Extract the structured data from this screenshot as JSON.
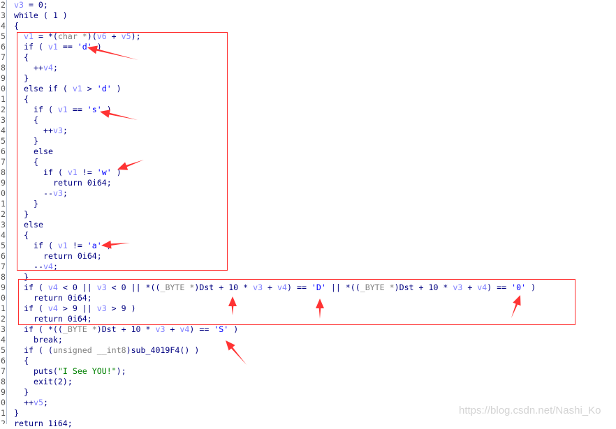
{
  "annotation_color": "#ff3333",
  "watermark": "https://blog.csdn.net/Nashi_Ko",
  "lines": [
    {
      "ln": "2",
      "indent": 0,
      "t": [
        [
          "v3",
          "v"
        ],
        [
          " = 0;",
          "k"
        ]
      ]
    },
    {
      "ln": "3",
      "indent": 0,
      "t": [
        [
          "while ( 1 )",
          "k"
        ]
      ]
    },
    {
      "ln": "4",
      "indent": 0,
      "t": [
        [
          "{",
          "k"
        ]
      ]
    },
    {
      "ln": "5",
      "indent": 1,
      "t": [
        [
          "v1",
          "v"
        ],
        [
          " = *(",
          "k"
        ],
        [
          "char *",
          "g"
        ],
        [
          ")(",
          "k"
        ],
        [
          "v6",
          "v"
        ],
        [
          " + ",
          "k"
        ],
        [
          "v5",
          "v"
        ],
        [
          ");",
          "k"
        ]
      ]
    },
    {
      "ln": "6",
      "indent": 1,
      "t": [
        [
          "if ( ",
          "k"
        ],
        [
          "v1",
          "v"
        ],
        [
          " == ",
          "k"
        ],
        [
          "'d'",
          "c"
        ],
        [
          " )",
          "k"
        ]
      ]
    },
    {
      "ln": "7",
      "indent": 1,
      "t": [
        [
          "{",
          "k"
        ]
      ]
    },
    {
      "ln": "8",
      "indent": 2,
      "t": [
        [
          "++",
          "k"
        ],
        [
          "v4",
          "v"
        ],
        [
          ";",
          "k"
        ]
      ]
    },
    {
      "ln": "9",
      "indent": 1,
      "t": [
        [
          "}",
          "k"
        ]
      ]
    },
    {
      "ln": "0",
      "indent": 1,
      "t": [
        [
          "else if ( ",
          "k"
        ],
        [
          "v1",
          "v"
        ],
        [
          " > ",
          "k"
        ],
        [
          "'d'",
          "c"
        ],
        [
          " )",
          "k"
        ]
      ]
    },
    {
      "ln": "1",
      "indent": 1,
      "t": [
        [
          "{",
          "k"
        ]
      ]
    },
    {
      "ln": "2",
      "indent": 2,
      "t": [
        [
          "if ( ",
          "k"
        ],
        [
          "v1",
          "v"
        ],
        [
          " == ",
          "k"
        ],
        [
          "'s'",
          "c"
        ],
        [
          " )",
          "k"
        ]
      ]
    },
    {
      "ln": "3",
      "indent": 2,
      "t": [
        [
          "{",
          "k"
        ]
      ]
    },
    {
      "ln": "4",
      "indent": 3,
      "t": [
        [
          "++",
          "k"
        ],
        [
          "v3",
          "v"
        ],
        [
          ";",
          "k"
        ]
      ]
    },
    {
      "ln": "5",
      "indent": 2,
      "t": [
        [
          "}",
          "k"
        ]
      ]
    },
    {
      "ln": "6",
      "indent": 2,
      "t": [
        [
          "else",
          "k"
        ]
      ]
    },
    {
      "ln": "7",
      "indent": 2,
      "t": [
        [
          "{",
          "k"
        ]
      ]
    },
    {
      "ln": "8",
      "indent": 3,
      "t": [
        [
          "if ( ",
          "k"
        ],
        [
          "v1",
          "v"
        ],
        [
          " != ",
          "k"
        ],
        [
          "'w'",
          "c"
        ],
        [
          " )",
          "k"
        ]
      ]
    },
    {
      "ln": "9",
      "indent": 4,
      "t": [
        [
          "return 0i64;",
          "k"
        ]
      ]
    },
    {
      "ln": "0",
      "indent": 3,
      "t": [
        [
          "--",
          "k"
        ],
        [
          "v3",
          "v"
        ],
        [
          ";",
          "k"
        ]
      ]
    },
    {
      "ln": "1",
      "indent": 2,
      "t": [
        [
          "}",
          "k"
        ]
      ]
    },
    {
      "ln": "2",
      "indent": 1,
      "t": [
        [
          "}",
          "k"
        ]
      ]
    },
    {
      "ln": "3",
      "indent": 1,
      "t": [
        [
          "else",
          "k"
        ]
      ]
    },
    {
      "ln": "4",
      "indent": 1,
      "t": [
        [
          "{",
          "k"
        ]
      ]
    },
    {
      "ln": "5",
      "indent": 2,
      "t": [
        [
          "if ( ",
          "k"
        ],
        [
          "v1",
          "v"
        ],
        [
          " != ",
          "k"
        ],
        [
          "'a'",
          "c"
        ],
        [
          " )",
          "k"
        ]
      ]
    },
    {
      "ln": "6",
      "indent": 3,
      "t": [
        [
          "return 0i64;",
          "k"
        ]
      ]
    },
    {
      "ln": "7",
      "indent": 2,
      "t": [
        [
          "--",
          "k"
        ],
        [
          "v4",
          "v"
        ],
        [
          ";",
          "k"
        ]
      ]
    },
    {
      "ln": "8",
      "indent": 1,
      "t": [
        [
          "}",
          "k"
        ]
      ]
    },
    {
      "ln": "9",
      "indent": 1,
      "t": [
        [
          "if ( ",
          "k"
        ],
        [
          "v4",
          "v"
        ],
        [
          " < 0 || ",
          "k"
        ],
        [
          "v3",
          "v"
        ],
        [
          " < 0 || *((",
          "k"
        ],
        [
          "_BYTE *",
          "g"
        ],
        [
          ")Dst + 10 * ",
          "k"
        ],
        [
          "v3",
          "v"
        ],
        [
          " + ",
          "k"
        ],
        [
          "v4",
          "v"
        ],
        [
          ") == ",
          "k"
        ],
        [
          "'D'",
          "c"
        ],
        [
          " || *((",
          "k"
        ],
        [
          "_BYTE *",
          "g"
        ],
        [
          ")Dst + 10 * ",
          "k"
        ],
        [
          "v3",
          "v"
        ],
        [
          " + ",
          "k"
        ],
        [
          "v4",
          "v"
        ],
        [
          ") == ",
          "k"
        ],
        [
          "'0'",
          "c"
        ],
        [
          " )",
          "k"
        ]
      ]
    },
    {
      "ln": "0",
      "indent": 2,
      "t": [
        [
          "return 0i64;",
          "k"
        ]
      ]
    },
    {
      "ln": "1",
      "indent": 1,
      "t": [
        [
          "if ( ",
          "k"
        ],
        [
          "v4",
          "v"
        ],
        [
          " > 9 || ",
          "k"
        ],
        [
          "v3",
          "v"
        ],
        [
          " > 9 )",
          "k"
        ]
      ]
    },
    {
      "ln": "2",
      "indent": 2,
      "t": [
        [
          "return 0i64;",
          "k"
        ]
      ]
    },
    {
      "ln": "3",
      "indent": 1,
      "t": [
        [
          "if ( *((",
          "k"
        ],
        [
          "_BYTE *",
          "g"
        ],
        [
          ")Dst + 10 * ",
          "k"
        ],
        [
          "v3",
          "v"
        ],
        [
          " + ",
          "k"
        ],
        [
          "v4",
          "v"
        ],
        [
          ") == ",
          "k"
        ],
        [
          "'S'",
          "c"
        ],
        [
          " )",
          "k"
        ]
      ]
    },
    {
      "ln": "4",
      "indent": 2,
      "t": [
        [
          "break;",
          "k"
        ]
      ]
    },
    {
      "ln": "5",
      "indent": 1,
      "t": [
        [
          "if ( (",
          "k"
        ],
        [
          "unsigned __int8",
          "g"
        ],
        [
          ")sub_4019F4() )",
          "k"
        ]
      ]
    },
    {
      "ln": "6",
      "indent": 1,
      "t": [
        [
          "{",
          "k"
        ]
      ]
    },
    {
      "ln": "7",
      "indent": 2,
      "t": [
        [
          "puts(",
          "k"
        ],
        [
          "\"I See YOU!\"",
          "s"
        ],
        [
          ");",
          "k"
        ]
      ]
    },
    {
      "ln": "8",
      "indent": 2,
      "t": [
        [
          "exit(2);",
          "k"
        ]
      ]
    },
    {
      "ln": "9",
      "indent": 1,
      "t": [
        [
          "}",
          "k"
        ]
      ]
    },
    {
      "ln": "0",
      "indent": 1,
      "t": [
        [
          "++",
          "k"
        ],
        [
          "v5",
          "v"
        ],
        [
          ";",
          "k"
        ]
      ]
    },
    {
      "ln": "1",
      "indent": 0,
      "t": [
        [
          "}",
          "k"
        ]
      ]
    },
    {
      "ln": "2",
      "indent": 0,
      "t": [
        [
          "return 1i64;",
          "k"
        ]
      ]
    }
  ]
}
